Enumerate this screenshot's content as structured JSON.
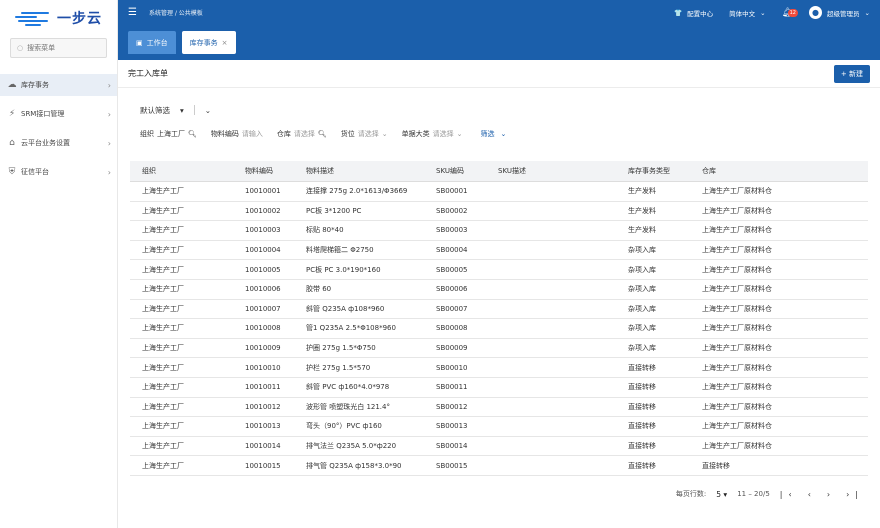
{
  "sidebar": {
    "logo_text": "一步云",
    "search_placeholder": "搜索菜单",
    "items": [
      {
        "label": "库存事务",
        "icon": "cloud-icon",
        "active": true
      },
      {
        "label": "SRM接口管理",
        "icon": "plug-icon",
        "active": false
      },
      {
        "label": "云平台业务设置",
        "icon": "home-icon",
        "active": false
      },
      {
        "label": "征信平台",
        "icon": "shield-icon",
        "active": false
      }
    ]
  },
  "header": {
    "breadcrumb": "系统管理 / 公共模板",
    "config_center": "配置中心",
    "language": "简体中文",
    "notification_count": "12",
    "user": "超级管理员"
  },
  "tabs": {
    "home": "工作台",
    "current": "库存事务"
  },
  "page": {
    "title": "完工入库单",
    "new_button": "+ 新建"
  },
  "filter": {
    "preset": "默认筛选",
    "org_label": "组织",
    "org_value": "上海工厂",
    "material_label": "物料编码",
    "material_placeholder": "请输入",
    "warehouse_label": "仓库",
    "warehouse_placeholder": "请选择",
    "location_label": "货位",
    "location_placeholder": "请选择",
    "category_label": "单据大类",
    "category_placeholder": "请选择",
    "more_filter": "筛选"
  },
  "table": {
    "headers": [
      "组织",
      "物料编码",
      "物料描述",
      "SKU编码",
      "SKU描述",
      "库存事务类型",
      "仓库"
    ],
    "rows": [
      [
        "上海生产工厂",
        "10010001",
        "连接撑 275g 2.0*1613/Φ3669",
        "SB00001",
        "",
        "生产发料",
        "上海生产工厂原材料仓"
      ],
      [
        "上海生产工厂",
        "10010002",
        "PC板 3*1200 PC",
        "SB00002",
        "",
        "生产发料",
        "上海生产工厂原材料仓"
      ],
      [
        "上海生产工厂",
        "10010003",
        "标贴 80*40",
        "SB00003",
        "",
        "生产发料",
        "上海生产工厂原材料仓"
      ],
      [
        "上海生产工厂",
        "10010004",
        "料塔爬梯箍二 Φ2750",
        "SB00004",
        "",
        "杂项入库",
        "上海生产工厂原材料仓"
      ],
      [
        "上海生产工厂",
        "10010005",
        "PC板 PC 3.0*190*160",
        "SB00005",
        "",
        "杂项入库",
        "上海生产工厂原材料仓"
      ],
      [
        "上海生产工厂",
        "10010006",
        "胶带 60",
        "SB00006",
        "",
        "杂项入库",
        "上海生产工厂原材料仓"
      ],
      [
        "上海生产工厂",
        "10010007",
        "斜管 Q235A ф108*960",
        "SB00007",
        "",
        "杂项入库",
        "上海生产工厂原材料仓"
      ],
      [
        "上海生产工厂",
        "10010008",
        "管1 Q235A 2.5*Φ108*960",
        "SB00008",
        "",
        "杂项入库",
        "上海生产工厂原材料仓"
      ],
      [
        "上海生产工厂",
        "10010009",
        "护圈 275g 1.5*Φ750",
        "SB00009",
        "",
        "杂项入库",
        "上海生产工厂原材料仓"
      ],
      [
        "上海生产工厂",
        "10010010",
        "护栏 275g 1.5*570",
        "SB00010",
        "",
        "直接转移",
        "上海生产工厂原材料仓"
      ],
      [
        "上海生产工厂",
        "10010011",
        "斜管 PVC ф160*4.0*978",
        "SB00011",
        "",
        "直接转移",
        "上海生产工厂原材料仓"
      ],
      [
        "上海生产工厂",
        "10010012",
        "波形管 喷塑珠光白 121.4°",
        "SB00012",
        "",
        "直接转移",
        "上海生产工厂原材料仓"
      ],
      [
        "上海生产工厂",
        "10010013",
        "弯头（90°）PVC ф160",
        "SB00013",
        "",
        "直接转移",
        "上海生产工厂原材料仓"
      ],
      [
        "上海生产工厂",
        "10010014",
        "排气法兰 Q235A 5.0*ф220",
        "SB00014",
        "",
        "直接转移",
        "上海生产工厂原材料仓"
      ],
      [
        "上海生产工厂",
        "10010015",
        "排气管 Q235A ф158*3.0*90",
        "SB00015",
        "",
        "直接转移",
        "直接转移"
      ]
    ]
  },
  "pager": {
    "rows_per_page_label": "每页行数:",
    "rows_per_page": "5",
    "range": "11 – 20/5"
  },
  "colors": {
    "brand": "#1b5fab",
    "badge": "#f04b3c"
  }
}
